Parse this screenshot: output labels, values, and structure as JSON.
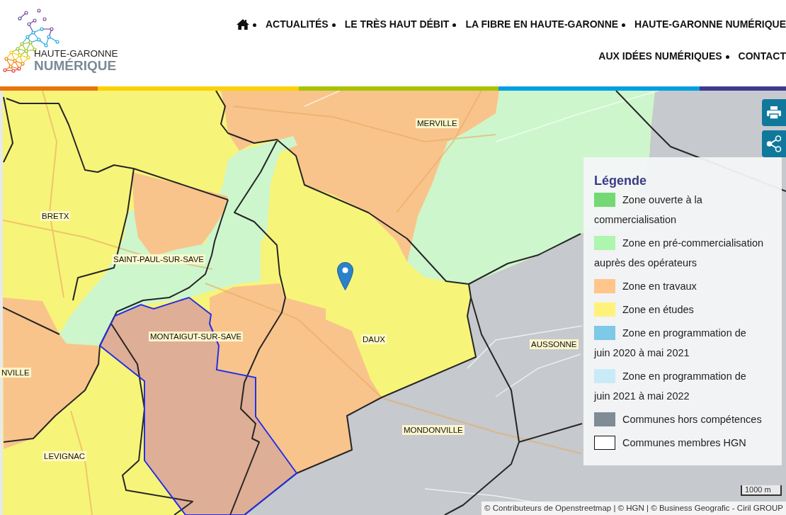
{
  "header": {
    "logo": {
      "line1": "HAUTE-GARONNE",
      "line2": "NUMÉRIQUE"
    },
    "nav": {
      "rows": [
        {
          "items": [
            {
              "kind": "home"
            },
            {
              "kind": "link",
              "label": "ACTUALITÉS"
            },
            {
              "kind": "link",
              "label": "LE TRÈS HAUT DÉBIT"
            },
            {
              "kind": "link",
              "label": "LA FIBRE EN HAUTE-GARONNE"
            },
            {
              "kind": "link",
              "label": "HAUTE-GARONNE NUMÉRIQUE"
            }
          ]
        },
        {
          "items": [
            {
              "kind": "link",
              "label": "AUX IDÉES NUMÉRIQUES"
            },
            {
              "kind": "link",
              "label": "CONTACT"
            }
          ]
        }
      ]
    }
  },
  "map": {
    "labels": [
      {
        "text": "MERVILLE"
      },
      {
        "text": "BRETX"
      },
      {
        "text": "SAINT-PAUL-SUR-SAVE"
      },
      {
        "text": "MONTAIGUT-SUR-SAVE"
      },
      {
        "text": "DAUX"
      },
      {
        "text": "NVILLE"
      },
      {
        "text": "LEVIGNAC"
      },
      {
        "text": "MONDONVILLE"
      },
      {
        "text": "AUSSONNE"
      }
    ],
    "tools": [
      {
        "kind": "print"
      },
      {
        "kind": "share"
      }
    ],
    "legend": {
      "title": "Légende",
      "items": [
        {
          "kind": "fill",
          "color": "#74d874",
          "label": "Zone ouverte à la commercialisation"
        },
        {
          "kind": "fill",
          "color": "#aef5ae",
          "label": "Zone en pré-commercialisation auprès des opérateurs"
        },
        {
          "kind": "fill",
          "color": "#ffc58a",
          "label": "Zone en travaux"
        },
        {
          "kind": "fill",
          "color": "#fff27a",
          "label": "Zone en études"
        },
        {
          "kind": "fill",
          "color": "#7ec8e8",
          "label": "Zone en programmation de juin 2020 à mai 2021"
        },
        {
          "kind": "fill",
          "color": "#c9ebf8",
          "label": "Zone en programmation de juin 2021 à mai 2022"
        },
        {
          "kind": "fill",
          "color": "#7f8c95",
          "label": "Communes hors compétences"
        },
        {
          "kind": "outline",
          "color": "#ffffff",
          "label": "Communes membres HGN"
        }
      ]
    },
    "scale": "1000 m",
    "attribution": "© Contributeurs de Openstreetmap | © HGN | © Business Geografic - Ciril GROUP"
  }
}
